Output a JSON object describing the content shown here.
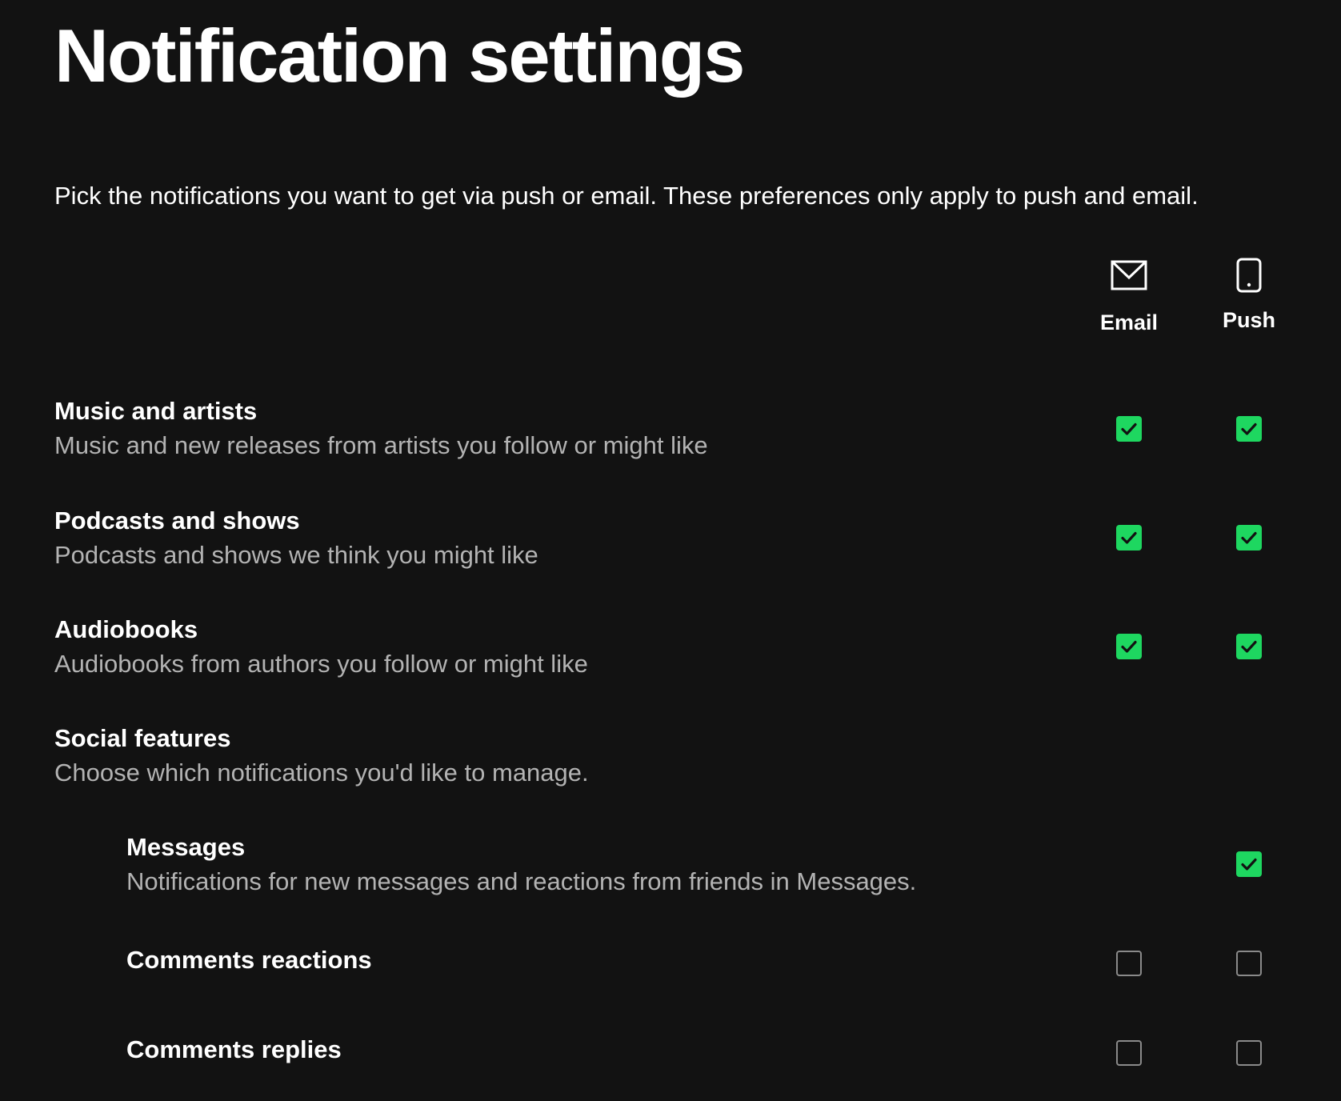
{
  "page": {
    "title": "Notification settings",
    "intro": "Pick the notifications you want to get via push or email. These preferences only apply to push and email."
  },
  "columns": {
    "email": {
      "label": "Email",
      "icon": "envelope-icon"
    },
    "push": {
      "label": "Push",
      "icon": "phone-icon"
    }
  },
  "rows": [
    {
      "title": "Music and artists",
      "description": "Music and new releases from artists you follow or might like",
      "email": true,
      "push": true
    },
    {
      "title": "Podcasts and shows",
      "description": "Podcasts and shows we think you might like",
      "email": true,
      "push": true
    },
    {
      "title": "Audiobooks",
      "description": "Audiobooks from authors you follow or might like",
      "email": true,
      "push": true
    },
    {
      "title": "Social features",
      "description": "Choose which notifications you'd like to manage."
    },
    {
      "title": "Messages",
      "description": "Notifications for new messages and reactions from friends in Messages.",
      "push": true
    },
    {
      "title": "Comments reactions",
      "email": false,
      "push": false
    },
    {
      "title": "Comments replies",
      "email": false,
      "push": false
    }
  ],
  "colors": {
    "background": "#121212",
    "accent": "#1ed760",
    "secondary_text": "#b3b3b3"
  }
}
